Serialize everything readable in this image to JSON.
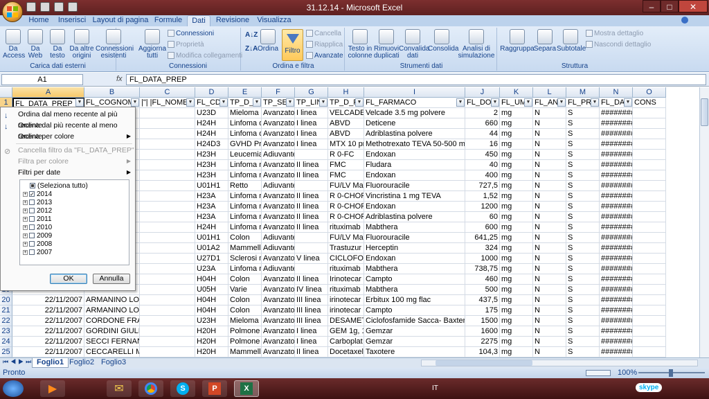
{
  "window": {
    "title": "31.12.14 - Microsoft Excel"
  },
  "ribbon_tabs": [
    "Home",
    "Inserisci",
    "Layout di pagina",
    "Formule",
    "Dati",
    "Revisione",
    "Visualizza"
  ],
  "ribbon": {
    "groups": {
      "external": "Carica dati esterni",
      "connections": "Connessioni",
      "sort_filter": "Ordina e filtra",
      "data_tools": "Strumenti dati",
      "outline": "Struttura"
    },
    "buttons": {
      "from_access": "Da Access",
      "from_web": "Da Web",
      "from_text": "Da testo",
      "from_other": "Da altre origini",
      "existing_conn": "Connessioni esistenti",
      "refresh_all": "Aggiorna tutti",
      "connections": "Connessioni",
      "properties": "Proprietà",
      "edit_links": "Modifica collegamenti",
      "sort": "Ordina",
      "filter": "Filtro",
      "clear": "Cancella",
      "reapply": "Riapplica",
      "advanced": "Avanzate",
      "text_to_columns": "Testo in colonne",
      "remove_duplicates": "Rimuovi duplicati",
      "data_validation": "Convalida dati",
      "consolidate": "Consolida",
      "what_if": "Analisi di simulazione",
      "group": "Raggruppa",
      "ungroup": "Separa",
      "subtotal": "Subtotale",
      "show_detail": "Mostra dettaglio",
      "hide_detail": "Nascondi dettaglio"
    }
  },
  "formula_bar": {
    "name_box": "A1",
    "fx": "fx",
    "formula": "FL_DATA_PREP"
  },
  "columns": [
    "A",
    "B",
    "C",
    "D",
    "E",
    "F",
    "G",
    "H",
    "I",
    "J",
    "K",
    "L",
    "M",
    "N",
    "O"
  ],
  "header_row": [
    "FL_DATA_PREP",
    "FL_COGNOME",
    "|\"| |FL_NOME",
    "FL_CDC",
    "TP_D_F",
    "TP_SET",
    "TP_LIN",
    "TP_D_F",
    "FL_FARMACO",
    "FL_DOS",
    "FL_UM",
    "FL_ANN",
    "FL_PRE",
    "FL_DAT",
    "CONS"
  ],
  "rows": [
    {
      "n": "2",
      "cells": [
        "",
        "PPE",
        "",
        "U23D",
        "Mieloma",
        "Avanzato",
        "I linea",
        "VELCADE-",
        "Velcade 3.5 mg polvere",
        "2",
        "mg",
        "N",
        "S",
        "#########",
        ""
      ]
    },
    {
      "n": "3",
      "cells": [
        "",
        "A",
        "",
        "H24H",
        "Linfoma d",
        "Avanzato",
        "I linea",
        "ABVD",
        "Deticene",
        "660",
        "mg",
        "N",
        "S",
        "#########",
        ""
      ]
    },
    {
      "n": "4",
      "cells": [
        "",
        "A",
        "",
        "H24H",
        "Linfoma d",
        "Avanzato",
        "I linea",
        "ABVD",
        "Adriblastina polvere",
        "44",
        "mg",
        "N",
        "S",
        "#########",
        ""
      ]
    },
    {
      "n": "5",
      "cells": [
        "",
        "",
        "",
        "H24D3",
        "GVHD Pro",
        "Avanzato",
        "I linea",
        "MTX 10 pr",
        "Methotrexato TEVA 50-500 mg",
        "16",
        "mg",
        "N",
        "S",
        "#########",
        ""
      ]
    },
    {
      "n": "6",
      "cells": [
        "",
        "ZIA",
        "",
        "H23H",
        "Leucemia",
        "Adiuvante",
        "",
        "R 0-FC",
        "Endoxan",
        "450",
        "mg",
        "N",
        "S",
        "#########",
        ""
      ]
    },
    {
      "n": "7",
      "cells": [
        "",
        "IO",
        "",
        "H23H",
        "Linfoma n",
        "Avanzato",
        "II linea",
        "FMC",
        "Fludara",
        "40",
        "mg",
        "N",
        "S",
        "#########",
        ""
      ]
    },
    {
      "n": "8",
      "cells": [
        "",
        "IO",
        "",
        "H23H",
        "Linfoma n",
        "Avanzato",
        "II linea",
        "FMC",
        "Endoxan",
        "400",
        "mg",
        "N",
        "S",
        "#########",
        ""
      ]
    },
    {
      "n": "9",
      "cells": [
        "",
        "E FAUSTO",
        "",
        "U01H1",
        "Retto",
        "Adiuvante",
        "",
        "FU/LV Ma",
        "Fluorouracile",
        "727,5",
        "mg",
        "N",
        "S",
        "#########",
        ""
      ]
    },
    {
      "n": "10",
      "cells": [
        "",
        "NCARLO",
        "",
        "H23A",
        "Linfoma n",
        "Avanzato",
        "II linea",
        "R 0-CHOP",
        "Vincristina 1 mg TEVA",
        "1,52",
        "mg",
        "N",
        "S",
        "#########",
        ""
      ]
    },
    {
      "n": "11",
      "cells": [
        "",
        "NCARLO",
        "",
        "H23A",
        "Linfoma n",
        "Avanzato",
        "II linea",
        "R 0-CHOP",
        "Endoxan",
        "1200",
        "mg",
        "N",
        "S",
        "#########",
        ""
      ]
    },
    {
      "n": "12",
      "cells": [
        "",
        "NCARLO",
        "",
        "H23A",
        "Linfoma n",
        "Avanzato",
        "II linea",
        "R 0-CHOP",
        "Adriblastina polvere",
        "60",
        "mg",
        "N",
        "S",
        "#########",
        ""
      ]
    },
    {
      "n": "13",
      "cells": [
        "",
        "ENZO",
        "",
        "H24H",
        "Linfoma n",
        "Avanzato",
        "II linea",
        "rituximab",
        "Mabthera",
        "600",
        "mg",
        "N",
        "S",
        "#########",
        ""
      ]
    },
    {
      "n": "14",
      "cells": [
        "",
        "ITO",
        "",
        "U01H1",
        "Colon",
        "Adiuvante",
        "",
        "FU/LV Ma",
        "Fluorouracile",
        "641,25",
        "mg",
        "N",
        "S",
        "#########",
        ""
      ]
    },
    {
      "n": "15",
      "cells": [
        "",
        "A TERESA",
        "",
        "U01A2",
        "Mammell",
        "Adiuvante",
        "",
        "Trastuzur",
        "Herceptin",
        "324",
        "mg",
        "N",
        "S",
        "#########",
        ""
      ]
    },
    {
      "n": "16",
      "cells": [
        "",
        "MO",
        "",
        "U27D1",
        "Sclerosi m",
        "Avanzato",
        "V linea",
        "CICLOFOS",
        "Endoxan",
        "1000",
        "mg",
        "N",
        "S",
        "#########",
        ""
      ]
    },
    {
      "n": "17",
      "cells": [
        "",
        "",
        "",
        "U23A",
        "Linfoma n",
        "Adiuvante",
        "",
        "rituximab",
        "Mabthera",
        "738,75",
        "mg",
        "N",
        "S",
        "#########",
        ""
      ]
    },
    {
      "n": "18",
      "cells": [
        "",
        "NNINA",
        "",
        "H04H",
        "Colon",
        "Avanzato",
        "II linea",
        "Irinotecar",
        "Campto",
        "460",
        "mg",
        "N",
        "S",
        "#########",
        ""
      ]
    },
    {
      "n": "19",
      "cells": [
        "",
        "",
        "",
        "U05H",
        "Varie",
        "Avanzato",
        "IV linea",
        "rituximab",
        "Mabthera",
        "500",
        "mg",
        "N",
        "S",
        "#########",
        ""
      ]
    },
    {
      "n": "20",
      "cells": [
        "22/11/2007",
        "ARMANINO LORENZO",
        "",
        "H04H",
        "Colon",
        "Avanzato",
        "III linea",
        " irinotecar",
        "Erbitux 100 mg flac",
        "437,5",
        "mg",
        "N",
        "S",
        "#########",
        ""
      ]
    },
    {
      "n": "21",
      "cells": [
        "22/11/2007",
        "ARMANINO LORENZO",
        "",
        "H04H",
        "Colon",
        "Avanzato",
        "III linea",
        " irinotecar",
        "Campto",
        "175",
        "mg",
        "N",
        "S",
        "#########",
        ""
      ]
    },
    {
      "n": "22",
      "cells": [
        "22/11/2007",
        "CORDONE FRANCA",
        "",
        "U23H",
        "Mieloma",
        "Avanzato",
        "III linea",
        "DESAMET/",
        "Ciclofosfamide Sacca- Baxter",
        "1500",
        "mg",
        "N",
        "S",
        "#########",
        ""
      ]
    },
    {
      "n": "23",
      "cells": [
        "22/11/2007",
        "GORDINI GIULIO GINO ARM",
        "",
        "H20H",
        "Polmone",
        "Avanzato",
        "I linea",
        "GEM  1g, 1",
        "Gemzar",
        "1600",
        "mg",
        "N",
        "S",
        "#########",
        ""
      ]
    },
    {
      "n": "24",
      "cells": [
        "22/11/2007",
        "SECCI FERNANDO",
        "",
        "H20H",
        "Polmone",
        "Avanzato",
        "I linea",
        "Carboplat",
        "Gemzar",
        "2275",
        "mg",
        "N",
        "S",
        "#########",
        ""
      ]
    },
    {
      "n": "25",
      "cells": [
        "22/11/2007",
        "CECCARELLI MARIA ROSA",
        "",
        "H20H",
        "Mammell",
        "Avanzato",
        "II linea",
        "Docetaxel",
        "Taxotere",
        "104,3",
        "mg",
        "N",
        "S",
        "#########",
        ""
      ]
    }
  ],
  "filter_menu": {
    "sort_asc": "Ordina dal meno recente al più recente",
    "sort_desc": "Ordina dal più recente al meno recente",
    "sort_color": "Ordina per colore",
    "clear_filter": "Cancella filtro da \"FL_DATA_PREP\"",
    "filter_color": "Filtra per colore",
    "date_filters": "Filtri per date",
    "items": [
      {
        "label": "(Seleziona tutto)",
        "state": "partial",
        "expander": false
      },
      {
        "label": "2014",
        "state": "checked",
        "expander": true
      },
      {
        "label": "2013",
        "state": "unchecked",
        "expander": true
      },
      {
        "label": "2012",
        "state": "unchecked",
        "expander": true
      },
      {
        "label": "2011",
        "state": "unchecked",
        "expander": true
      },
      {
        "label": "2010",
        "state": "unchecked",
        "expander": true
      },
      {
        "label": "2009",
        "state": "unchecked",
        "expander": true
      },
      {
        "label": "2008",
        "state": "unchecked",
        "expander": true
      },
      {
        "label": "2007",
        "state": "unchecked",
        "expander": true
      }
    ],
    "ok": "OK",
    "cancel": "Annulla"
  },
  "sheet_tabs": [
    "Foglio1",
    "Foglio2",
    "Foglio3"
  ],
  "status": {
    "ready": "Pronto",
    "zoom": "100%"
  },
  "taskbar": {
    "lang": "IT",
    "skype": "skype"
  }
}
